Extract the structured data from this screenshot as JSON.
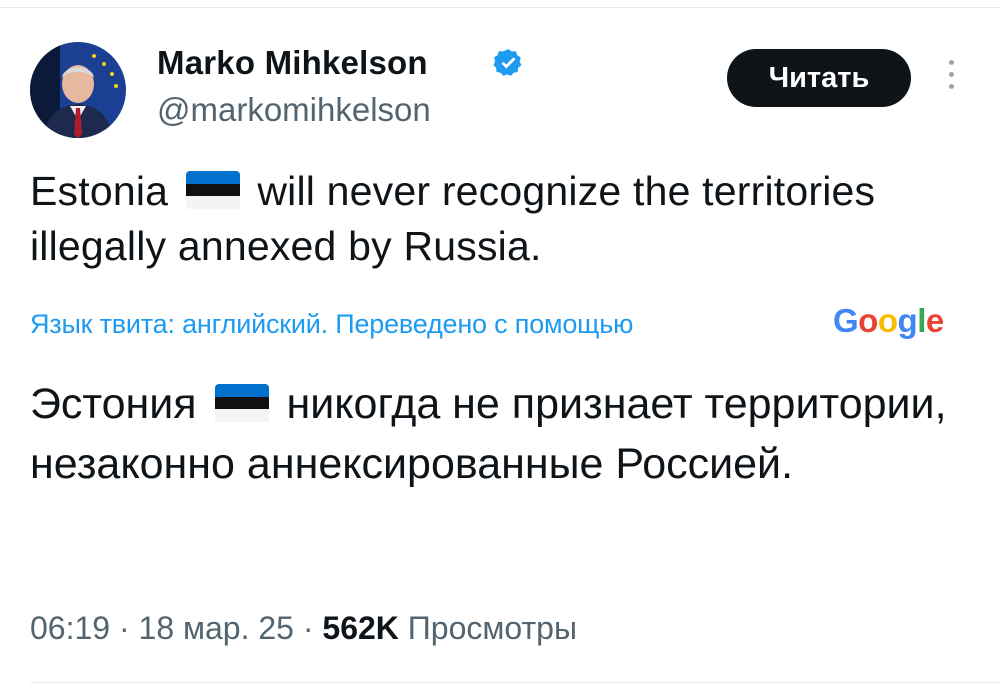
{
  "author": {
    "name": "Marko Mihkelson",
    "handle": "@markomihkelson",
    "verified": true
  },
  "follow_button_label": "Читать",
  "tweet": {
    "text_part1": "Estonia",
    "text_part2": "will never recognize the territories illegally annexed by Russia.",
    "flag_icon": "estonia-flag-icon"
  },
  "translation": {
    "note": "Язык твита: английский. Переведено с помощью",
    "provider": "Google",
    "text_part1": "Эстония",
    "text_part2": "никогда не признает территории, незаконно аннексированные Россией."
  },
  "meta": {
    "time": "06:19",
    "date": "18 мар. 25",
    "separator": "·",
    "views_count": "562K",
    "views_label": "Просмотры"
  },
  "colors": {
    "accent": "#1d9bf0",
    "text": "#0f1419",
    "secondary": "#536471",
    "flag_blue": "#0072ce",
    "flag_black": "#111111",
    "flag_white": "#ffffff"
  }
}
